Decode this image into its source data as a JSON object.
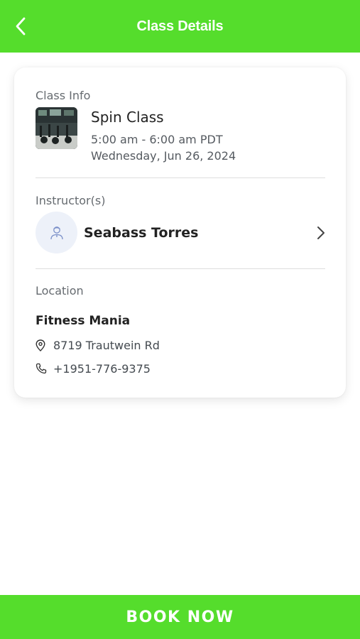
{
  "header": {
    "title": "Class Details",
    "back_icon": "chevron-left-icon"
  },
  "class_info": {
    "label": "Class Info",
    "name": "Spin Class",
    "time": "5:00 am - 6:00 am PDT",
    "date": "Wednesday, Jun 26, 2024",
    "thumbnail_icon": "class-photo"
  },
  "instructors": {
    "label": "Instructor(s)",
    "items": [
      {
        "name": "Seabass Torres",
        "avatar_icon": "person-icon"
      }
    ]
  },
  "location": {
    "label": "Location",
    "venue": "Fitness Mania",
    "address": "8719 Trautwein Rd",
    "phone": "+1951-776-9375",
    "address_icon": "map-pin-icon",
    "phone_icon": "phone-icon"
  },
  "footer": {
    "book_label": "BOOK NOW"
  },
  "colors": {
    "accent": "#55dd2c",
    "text": "#222222",
    "muted": "#666b70",
    "avatar_bg": "#edf1f9"
  }
}
